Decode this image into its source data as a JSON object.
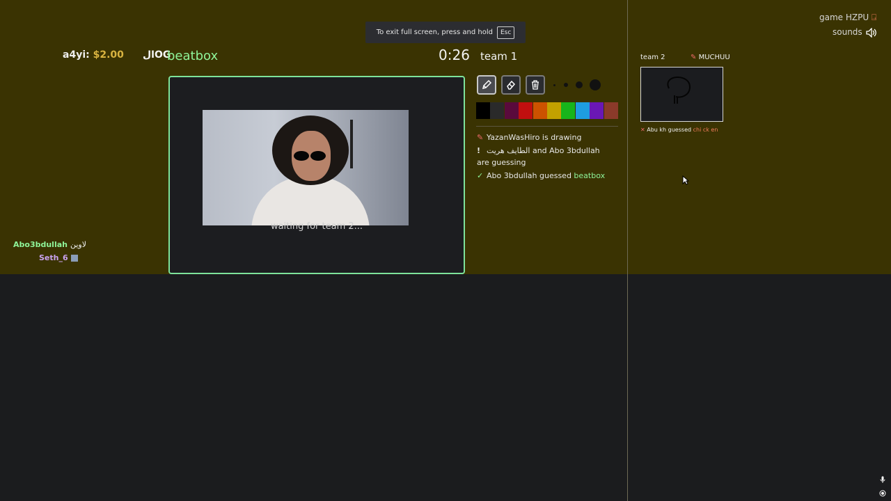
{
  "fullscreen_notice": {
    "text": "To exit full screen, press and hold",
    "key": "Esc"
  },
  "stream_overlay": {
    "donor": "a4yi:",
    "amount": "$2.00",
    "og_text": "الOG",
    "word": "beatbox",
    "chat": [
      {
        "user": "Abo3bdullah",
        "text": "لاوين"
      },
      {
        "user": "Seth_6",
        "text": ""
      }
    ]
  },
  "game": {
    "timer": "0:26",
    "team1_title": "team 1",
    "canvas_status": "waiting for team 2...",
    "tools": [
      {
        "name": "pencil-tool",
        "active": true
      },
      {
        "name": "eraser-tool",
        "active": false
      },
      {
        "name": "trash-tool",
        "active": false
      }
    ],
    "brush_sizes": [
      "xs",
      "s",
      "m",
      "l"
    ],
    "palette": [
      "#000000",
      "#2a2a2a",
      "#5a0a3c",
      "#c10f0f",
      "#cc5200",
      "#c2a100",
      "#17b51b",
      "#1e9de0",
      "#6a17b5",
      "#8b3a2a"
    ],
    "messages": [
      {
        "icon": "pencil",
        "text": "YazanWasHiro is drawing",
        "highlight": ""
      },
      {
        "icon": "exclamation",
        "text": "الطايف هريت and Abo 3bdullah are guessing",
        "highlight": ""
      },
      {
        "icon": "check",
        "text": "Abo 3bdullah guessed ",
        "highlight": "beatbox"
      }
    ],
    "team2": {
      "label": "team 2",
      "drawer": "MUCHUU",
      "guess_user": "Abu kh guessed",
      "guess_word": "chi ck en"
    },
    "game_code": "game HZPU",
    "sounds_label": "sounds"
  },
  "colors": {
    "accent_green": "#7ee39a",
    "background_top": "#3a3302",
    "background_bottom": "#1b1c1e"
  }
}
